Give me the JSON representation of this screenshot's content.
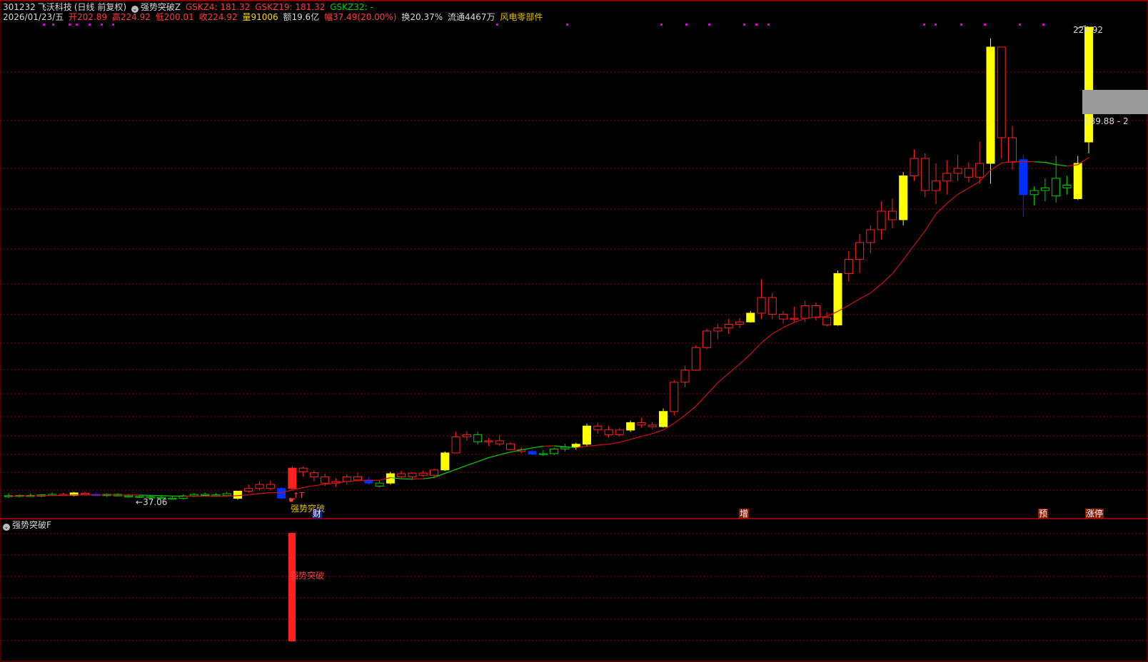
{
  "header": {
    "stock_code": "301232",
    "stock_name": "飞沃科技",
    "period": "(日线 前复权)",
    "indicator_name": "强势突破Z",
    "gskz4": "GSKZ4: 181.32",
    "gskz19": "GSKZ19: 181.32",
    "gskz32": "GSKZ32: -",
    "date": "2026/01/23/五",
    "open_label": "开",
    "open": "202.89",
    "high_label": "高",
    "high": "224.92",
    "low_label": "低",
    "low": "200.01",
    "close_label": "收",
    "close": "224.92",
    "volume_label": "量",
    "volume": "91006",
    "amount_label": "额",
    "amount": "19.6亿",
    "change_label": "幅",
    "change": "37.49(20.00%)",
    "turnover": "换20.37%",
    "float_shares": "流通4467万",
    "sector": "风电零部件"
  },
  "price_labels": {
    "high_mark": "224.92",
    "right_box": "189.88 - 2",
    "low_mark": "37.06"
  },
  "signal_text": "强势突破",
  "marker_labels": {
    "cai": "财",
    "zeng": "增",
    "yu": "预",
    "zhangting": "涨停"
  },
  "sub_panel": {
    "indicator_name": "强势突破F",
    "bar_text": "强势突破"
  },
  "colors": {
    "up": "#ff2020",
    "down_green": "#00d000",
    "yellow": "#ffff00",
    "blue": "#0030ff",
    "grid": "#8b0000",
    "ma_line": "#d01010"
  },
  "chart_data": {
    "type": "candlestick",
    "price_range": [
      37.06,
      224.92
    ],
    "candles": [
      {
        "o": 37.5,
        "h": 38.5,
        "l": 36.5,
        "c": 37.2,
        "k": "g"
      },
      {
        "o": 37.2,
        "h": 38.0,
        "l": 36.8,
        "c": 37.6,
        "k": "g"
      },
      {
        "o": 37.6,
        "h": 38.3,
        "l": 37.0,
        "c": 37.3,
        "k": "g"
      },
      {
        "o": 37.3,
        "h": 38.0,
        "l": 36.9,
        "c": 37.8,
        "k": "g"
      },
      {
        "o": 37.8,
        "h": 38.8,
        "l": 37.4,
        "c": 38.0,
        "k": "g"
      },
      {
        "o": 38.0,
        "h": 38.6,
        "l": 37.5,
        "c": 37.6,
        "k": "r"
      },
      {
        "o": 37.6,
        "h": 39.0,
        "l": 37.2,
        "c": 38.6,
        "k": "y"
      },
      {
        "o": 38.4,
        "h": 39.0,
        "l": 37.6,
        "c": 38.0,
        "k": "r"
      },
      {
        "o": 38.0,
        "h": 38.8,
        "l": 37.4,
        "c": 37.5,
        "k": "b"
      },
      {
        "o": 37.5,
        "h": 38.3,
        "l": 37.0,
        "c": 38.0,
        "k": "g"
      },
      {
        "o": 38.0,
        "h": 38.4,
        "l": 37.2,
        "c": 37.4,
        "k": "g"
      },
      {
        "o": 37.4,
        "h": 38.2,
        "l": 36.6,
        "c": 37.2,
        "k": "g"
      },
      {
        "o": 37.2,
        "h": 37.8,
        "l": 36.6,
        "c": 37.0,
        "k": "g"
      },
      {
        "o": 37.0,
        "h": 37.6,
        "l": 36.2,
        "c": 36.8,
        "k": "g"
      },
      {
        "o": 36.8,
        "h": 37.5,
        "l": 36.0,
        "c": 36.5,
        "k": "g"
      },
      {
        "o": 36.5,
        "h": 37.4,
        "l": 35.8,
        "c": 36.4,
        "k": "g"
      },
      {
        "o": 36.4,
        "h": 37.9,
        "l": 36.0,
        "c": 37.4,
        "k": "g"
      },
      {
        "o": 37.4,
        "h": 38.6,
        "l": 36.9,
        "c": 38.0,
        "k": "g"
      },
      {
        "o": 38.0,
        "h": 38.8,
        "l": 37.5,
        "c": 37.8,
        "k": "g"
      },
      {
        "o": 37.8,
        "h": 38.5,
        "l": 37.0,
        "c": 37.5,
        "k": "g"
      },
      {
        "o": 37.5,
        "h": 39.0,
        "l": 37.1,
        "c": 38.3,
        "k": "g"
      },
      {
        "o": 36.4,
        "h": 39.4,
        "l": 35.8,
        "c": 39.3,
        "k": "y"
      },
      {
        "o": 39.3,
        "h": 41.6,
        "l": 38.6,
        "c": 40.3,
        "k": "r"
      },
      {
        "o": 40.3,
        "h": 42.6,
        "l": 39.6,
        "c": 41.6,
        "k": "r"
      },
      {
        "o": 41.6,
        "h": 42.8,
        "l": 39.6,
        "c": 40.3,
        "k": "r"
      },
      {
        "o": 40.3,
        "h": 40.8,
        "l": 35.8,
        "c": 36.5,
        "k": "b"
      },
      {
        "o": 40.3,
        "h": 49.0,
        "l": 40.0,
        "c": 48.0,
        "k": "R"
      },
      {
        "o": 48.0,
        "h": 48.8,
        "l": 44.0,
        "c": 46.0,
        "k": "r"
      },
      {
        "o": 45.5,
        "h": 46.8,
        "l": 42.5,
        "c": 44.0,
        "k": "r"
      },
      {
        "o": 44.0,
        "h": 45.0,
        "l": 41.0,
        "c": 42.0,
        "k": "r"
      },
      {
        "o": 42.0,
        "h": 43.5,
        "l": 40.8,
        "c": 42.5,
        "k": "r"
      },
      {
        "o": 42.5,
        "h": 44.8,
        "l": 41.5,
        "c": 44.0,
        "k": "r"
      },
      {
        "o": 44.0,
        "h": 45.5,
        "l": 42.5,
        "c": 43.0,
        "k": "r"
      },
      {
        "o": 43.0,
        "h": 44.0,
        "l": 41.5,
        "c": 42.0,
        "k": "b"
      },
      {
        "o": 42.0,
        "h": 43.0,
        "l": 40.6,
        "c": 41.0,
        "k": "g"
      },
      {
        "o": 42.0,
        "h": 46.0,
        "l": 41.5,
        "c": 45.0,
        "k": "y"
      },
      {
        "o": 45.0,
        "h": 46.5,
        "l": 43.5,
        "c": 44.0,
        "k": "r"
      },
      {
        "o": 44.0,
        "h": 45.8,
        "l": 43.0,
        "c": 45.3,
        "k": "r"
      },
      {
        "o": 45.3,
        "h": 46.8,
        "l": 44.0,
        "c": 44.5,
        "k": "r"
      },
      {
        "o": 44.5,
        "h": 47.8,
        "l": 43.5,
        "c": 47.0,
        "k": "r"
      },
      {
        "o": 47.0,
        "h": 57.0,
        "l": 46.5,
        "c": 56.2,
        "k": "y"
      },
      {
        "o": 56.2,
        "h": 67.0,
        "l": 56.0,
        "c": 64.5,
        "k": "r"
      },
      {
        "o": 64.5,
        "h": 67.2,
        "l": 62.5,
        "c": 65.5,
        "k": "r"
      },
      {
        "o": 65.5,
        "h": 67.0,
        "l": 60.6,
        "c": 62.0,
        "k": "g"
      },
      {
        "o": 62.0,
        "h": 63.8,
        "l": 59.8,
        "c": 62.5,
        "k": "r"
      },
      {
        "o": 62.5,
        "h": 65.5,
        "l": 60.0,
        "c": 61.0,
        "k": "r"
      },
      {
        "o": 61.0,
        "h": 61.8,
        "l": 57.5,
        "c": 58.0,
        "k": "r"
      },
      {
        "o": 58.0,
        "h": 59.2,
        "l": 56.0,
        "c": 57.0,
        "k": "r"
      },
      {
        "o": 57.0,
        "h": 58.0,
        "l": 55.0,
        "c": 55.5,
        "k": "b"
      },
      {
        "o": 55.5,
        "h": 57.8,
        "l": 54.5,
        "c": 55.8,
        "k": "g"
      },
      {
        "o": 55.8,
        "h": 59.0,
        "l": 55.0,
        "c": 58.3,
        "k": "g"
      },
      {
        "o": 58.3,
        "h": 61.0,
        "l": 57.0,
        "c": 59.3,
        "k": "g"
      },
      {
        "o": 59.3,
        "h": 61.6,
        "l": 58.0,
        "c": 60.8,
        "k": "y"
      },
      {
        "o": 60.8,
        "h": 71.0,
        "l": 60.0,
        "c": 69.8,
        "k": "y"
      },
      {
        "o": 69.8,
        "h": 71.5,
        "l": 66.0,
        "c": 68.0,
        "k": "r"
      },
      {
        "o": 68.0,
        "h": 69.8,
        "l": 64.2,
        "c": 65.5,
        "k": "r"
      },
      {
        "o": 65.5,
        "h": 69.0,
        "l": 64.5,
        "c": 67.8,
        "k": "r"
      },
      {
        "o": 67.8,
        "h": 72.5,
        "l": 66.8,
        "c": 71.5,
        "k": "y"
      },
      {
        "o": 71.5,
        "h": 73.8,
        "l": 69.0,
        "c": 70.3,
        "k": "r"
      },
      {
        "o": 70.3,
        "h": 71.8,
        "l": 68.2,
        "c": 69.5,
        "k": "r"
      },
      {
        "o": 69.5,
        "h": 78.5,
        "l": 69.0,
        "c": 77.0,
        "k": "y"
      },
      {
        "o": 77.0,
        "h": 93.5,
        "l": 75.0,
        "c": 92.0,
        "k": "r"
      },
      {
        "o": 92.0,
        "h": 103.0,
        "l": 89.0,
        "c": 100.0,
        "k": "r"
      },
      {
        "o": 100.0,
        "h": 116.5,
        "l": 99.5,
        "c": 115.0,
        "k": "r"
      },
      {
        "o": 115.0,
        "h": 127.5,
        "l": 114.0,
        "c": 126.0,
        "k": "r"
      },
      {
        "o": 126.0,
        "h": 130.8,
        "l": 120.5,
        "c": 128.0,
        "k": "r"
      },
      {
        "o": 128.0,
        "h": 134.0,
        "l": 124.0,
        "c": 130.5,
        "k": "r"
      },
      {
        "o": 130.5,
        "h": 134.5,
        "l": 128.0,
        "c": 132.0,
        "k": "r"
      },
      {
        "o": 132.0,
        "h": 138.0,
        "l": 131.5,
        "c": 137.0,
        "k": "y"
      },
      {
        "o": 137.0,
        "h": 152.5,
        "l": 134.0,
        "c": 144.3,
        "k": "r"
      },
      {
        "o": 144.3,
        "h": 146.5,
        "l": 133.8,
        "c": 136.5,
        "k": "r"
      },
      {
        "o": 136.5,
        "h": 138.0,
        "l": 131.0,
        "c": 134.0,
        "k": "r"
      },
      {
        "o": 134.0,
        "h": 140.0,
        "l": 131.5,
        "c": 134.5,
        "k": "r"
      },
      {
        "o": 134.5,
        "h": 142.8,
        "l": 132.0,
        "c": 140.5,
        "k": "r"
      },
      {
        "o": 140.5,
        "h": 142.0,
        "l": 133.0,
        "c": 135.0,
        "k": "r"
      },
      {
        "o": 135.0,
        "h": 137.5,
        "l": 129.0,
        "c": 130.0,
        "k": "r"
      },
      {
        "o": 130.0,
        "h": 156.0,
        "l": 129.5,
        "c": 154.8,
        "k": "y"
      },
      {
        "o": 154.8,
        "h": 163.8,
        "l": 151.5,
        "c": 160.5,
        "k": "r"
      },
      {
        "o": 160.5,
        "h": 170.0,
        "l": 155.0,
        "c": 167.0,
        "k": "r"
      },
      {
        "o": 167.0,
        "h": 173.0,
        "l": 163.0,
        "c": 171.5,
        "k": "r"
      },
      {
        "o": 171.5,
        "h": 181.5,
        "l": 168.0,
        "c": 178.0,
        "k": "r"
      },
      {
        "o": 178.0,
        "h": 182.5,
        "l": 172.0,
        "c": 175.0,
        "k": "r"
      },
      {
        "o": 175.0,
        "h": 192.5,
        "l": 173.0,
        "c": 191.0,
        "k": "y"
      },
      {
        "o": 191.0,
        "h": 201.0,
        "l": 189.0,
        "c": 198.0,
        "k": "r"
      },
      {
        "o": 198.0,
        "h": 200.0,
        "l": 183.0,
        "c": 185.5,
        "k": "r"
      },
      {
        "o": 185.5,
        "h": 196.0,
        "l": 180.5,
        "c": 189.0,
        "k": "r"
      },
      {
        "o": 189.0,
        "h": 197.2,
        "l": 184.0,
        "c": 192.0,
        "k": "r"
      },
      {
        "o": 192.0,
        "h": 199.5,
        "l": 189.0,
        "c": 194.0,
        "k": "r"
      },
      {
        "o": 194.0,
        "h": 196.5,
        "l": 188.5,
        "c": 190.5,
        "k": "r"
      },
      {
        "o": 190.5,
        "h": 203.0,
        "l": 188.0,
        "c": 196.0,
        "k": "r"
      },
      {
        "o": 196.0,
        "h": 223.0,
        "l": 188.0,
        "c": 221.5,
        "k": "y"
      },
      {
        "o": 221.5,
        "h": 213.5,
        "l": 198.0,
        "c": 204.0,
        "k": "r"
      },
      {
        "o": 204.0,
        "h": 207.0,
        "l": 193.5,
        "c": 196.5,
        "k": "r"
      },
      {
        "o": 184.0,
        "h": 199.5,
        "l": 176.0,
        "c": 197.5,
        "k": "b"
      },
      {
        "o": 184.0,
        "h": 187.0,
        "l": 180.0,
        "c": 185.5,
        "k": "g"
      },
      {
        "o": 185.5,
        "h": 190.0,
        "l": 181.5,
        "c": 186.5,
        "k": "g"
      },
      {
        "o": 190.0,
        "h": 199.0,
        "l": 181.0,
        "c": 183.5,
        "k": "g"
      },
      {
        "o": 186.5,
        "h": 191.0,
        "l": 184.0,
        "c": 187.5,
        "k": "g"
      },
      {
        "o": 182.5,
        "h": 199.0,
        "l": 182.0,
        "c": 196.0,
        "k": "y"
      },
      {
        "o": 202.9,
        "h": 224.92,
        "l": 200.0,
        "c": 224.92,
        "k": "y"
      }
    ]
  }
}
